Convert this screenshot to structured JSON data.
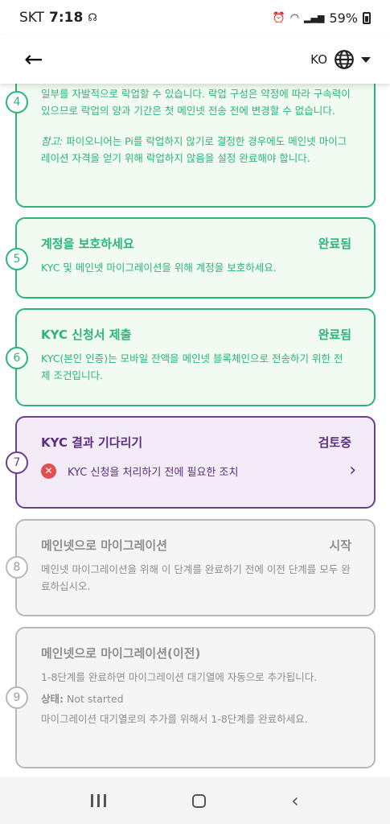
{
  "status": {
    "carrier": "SKT",
    "time": "7:18",
    "battery": "59%"
  },
  "appbar": {
    "lang": "KO"
  },
  "steps": [
    {
      "num": "4",
      "desc1": "일부를 자발적으로 락업할 수 있습니다. 락업 구성은 약정에 따라 구속력이 있으므로 락업의 양과 기간은 첫 메인넷 전송 전에 변경할 수 없습니다.",
      "note_label": "참고:",
      "note": " 파이오니어는 Pi를 락업하지 않기로 결정한 경우에도 메인넷 마이그레이션 자격을 얻기 위해 락업하지 않음을 설정 완료해야 합니다."
    },
    {
      "num": "5",
      "title": "계정을 보호하세요",
      "status": "완료됨",
      "desc": "KYC 및 메인넷 마이그레이션을 위해 계정을 보호하세요."
    },
    {
      "num": "6",
      "title": "KYC 신청서 제출",
      "status": "완료됨",
      "desc": "KYC(본인 인증)는 모바일 잔액을 메인넷 블록체인으로 전송하기 위한 전제 조건입니다."
    },
    {
      "num": "7",
      "title": "KYC 결과 기다리기",
      "status": "검토중",
      "action": "KYC 신청을 처리하기 전에 필요한 조치"
    },
    {
      "num": "8",
      "title": "메인넷으로 마이그레이션",
      "status": "시작",
      "desc": "메인넷 마이그레이션을 위해 이 단계를 완료하기 전에 이전 단계를 모두 완료하십시오."
    },
    {
      "num": "9",
      "title": "메인넷으로 마이그레이션(이전)",
      "desc": "1-8단계를 완료하면 마이그레이션 대기열에 자동으로 추가됩니다.",
      "state_label": "상태:",
      "state_value": " Not started",
      "desc2": "마이그레이션 대기열로의 추가를 위해서 1-8단계를 완료하세요."
    }
  ]
}
